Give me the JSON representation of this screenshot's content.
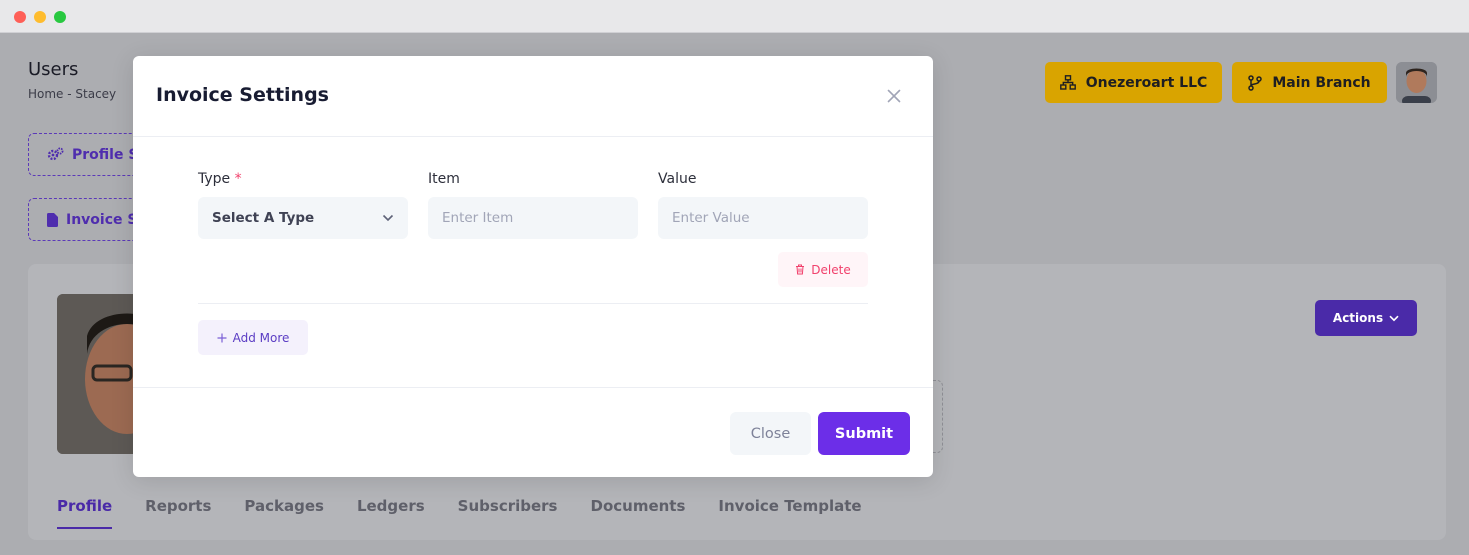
{
  "page": {
    "title": "Users",
    "breadcrumb": "Home  -  Stacey",
    "side_buttons": [
      "Profile Se",
      "Invoice Se"
    ],
    "company": "Onezeroart LLC",
    "branch": "Main Branch",
    "actions_label": "Actions",
    "tabs": [
      "Profile",
      "Reports",
      "Packages",
      "Ledgers",
      "Subscribers",
      "Documents",
      "Invoice Template"
    ]
  },
  "modal": {
    "title": "Invoice Settings",
    "type_label": "Type",
    "required_mark": "*",
    "item_label": "Item",
    "value_label": "Value",
    "type_selected": "Select A Type",
    "item_placeholder": "Enter Item",
    "value_placeholder": "Enter Value",
    "delete_label": "Delete",
    "add_more_label": "Add More",
    "close_label": "Close",
    "submit_label": "Submit"
  },
  "colors": {
    "primary": "#6c2ee8",
    "accent_yellow": "#d9a400",
    "danger": "#f1416c"
  }
}
